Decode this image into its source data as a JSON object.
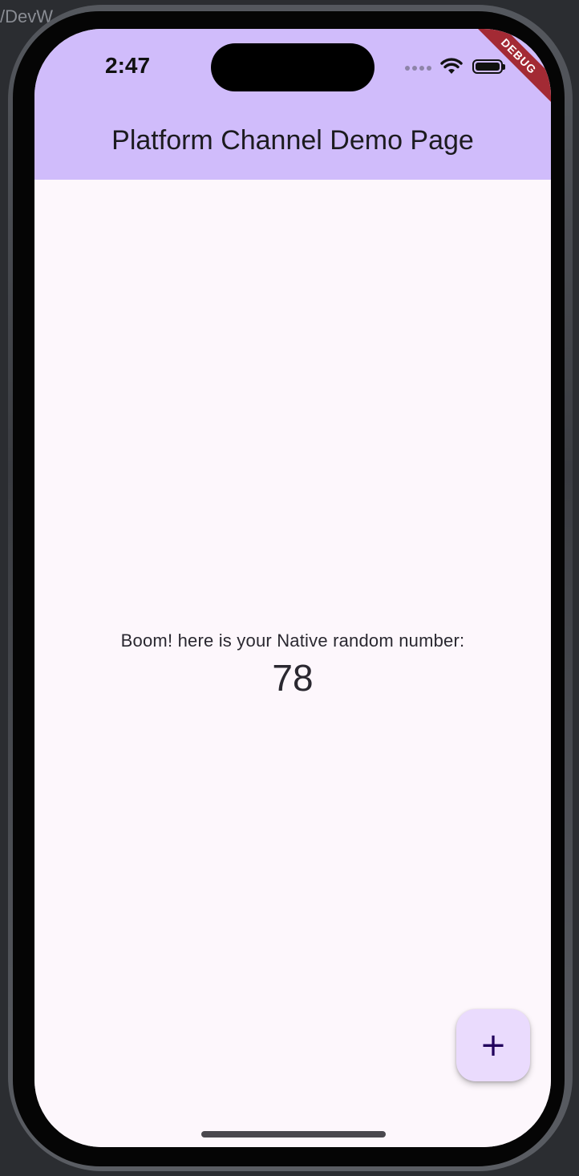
{
  "status_bar": {
    "time": "2:47",
    "debug_banner": "DEBUG"
  },
  "app_bar": {
    "title": "Platform Channel Demo Page"
  },
  "main": {
    "label": "Boom! here is your Native random number:",
    "number": "78"
  },
  "fab": {
    "icon": "plus-icon",
    "glyph": "+"
  },
  "colors": {
    "app_bar": "#d0bcfb",
    "background": "#fdf7fc",
    "fab": "#eadbfd",
    "fab_icon": "#22005d",
    "debug_banner": "#a32a34"
  }
}
